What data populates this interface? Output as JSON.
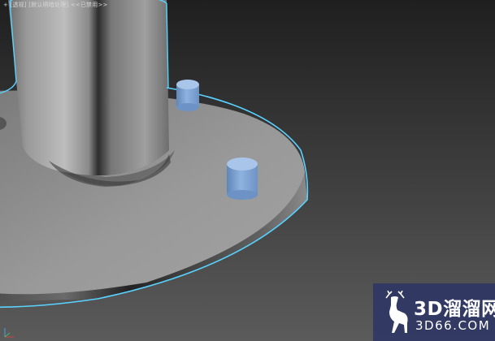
{
  "viewport": {
    "label_segments": [
      "+",
      "[透视]",
      "[默认明暗处理]",
      "<<已禁用>>"
    ],
    "background_top": "#1f1f1f",
    "background_bottom": "#5a5a5a",
    "selection_color": "#5ad2ff",
    "pin_color": "#7ea9d8"
  },
  "watermark": {
    "brand_text": "3D溜溜网",
    "url_text": "3D66.COM",
    "logo_icon": "deer-icon",
    "background": "#2c3464"
  },
  "axis_icon": "axis-tripod-icon"
}
